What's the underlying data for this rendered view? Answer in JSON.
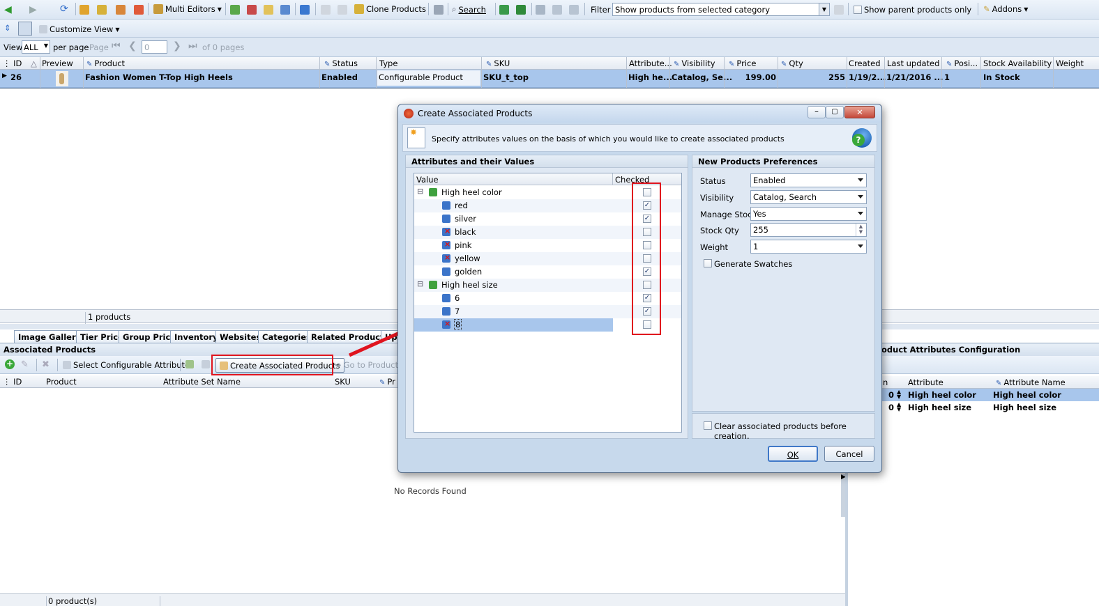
{
  "toolbar": {
    "multi_editors": "Multi Editors",
    "clone": "Clone Products",
    "search": "Search",
    "filter_label": "Filter",
    "filter_value": "Show products from selected category",
    "show_parent": "Show parent products only",
    "addons": "Addons"
  },
  "toolbar2": {
    "customize": "Customize View"
  },
  "pager": {
    "view": "View",
    "per_page_value": "ALL",
    "per_page": "per page",
    "page": "Page",
    "page_input": "0",
    "of_pages": "of 0 pages"
  },
  "grid": {
    "headers": [
      "ID",
      "Preview",
      "Product",
      "Status",
      "Type",
      "SKU",
      "Attribute...",
      "Visibility",
      "Price",
      "Qty",
      "Created",
      "Last updated",
      "Posi...",
      "Stock Availability",
      "Weight"
    ],
    "row": {
      "id": "26",
      "product": "Fashion Women T-Top High Heels",
      "status": "Enabled",
      "type": "Configurable Product",
      "sku": "SKU_t_top",
      "attribute": "High he...",
      "visibility": "Catalog, Se...",
      "price": "199.00",
      "qty": "255",
      "created": "1/19/2...",
      "updated": "1/21/2016 ...",
      "position": "1",
      "stock": "In Stock"
    },
    "count": "1 products"
  },
  "tabs": [
    "Image Gallery",
    "Tier Price",
    "Group Price",
    "Inventory",
    "Websites",
    "Categories",
    "Related Products",
    "Up"
  ],
  "assoc": {
    "title": "Associated Products",
    "select_btn": "Select Configurable Attributes",
    "create_btn": "Create Associated Products",
    "goto_btn": "Go to Product",
    "headers": [
      "ID",
      "Product",
      "Attribute Set Name",
      "SKU",
      "Pr"
    ],
    "empty": "No Records Found",
    "count": "0 product(s)"
  },
  "config": {
    "title": "oduct Attributes Configuration",
    "headers": [
      "n",
      "Attribute",
      "Attribute Name"
    ],
    "rows": [
      {
        "pos": "0",
        "attr": "High heel color",
        "name": "High heel color"
      },
      {
        "pos": "0",
        "attr": "High heel size",
        "name": "High heel size"
      }
    ]
  },
  "dialog": {
    "title": "Create Associated Products",
    "desc": "Specify attributes values on the basis of which you would like to create associated products",
    "left_title": "Attributes and their Values",
    "col_value": "Value",
    "col_checked": "Checked",
    "tree": [
      {
        "label": "High heel color",
        "group": true,
        "checked": false
      },
      {
        "label": "red",
        "group": false,
        "checked": true,
        "used": false
      },
      {
        "label": "silver",
        "group": false,
        "checked": true,
        "used": false
      },
      {
        "label": "black",
        "group": false,
        "checked": false,
        "used": true
      },
      {
        "label": "pink",
        "group": false,
        "checked": false,
        "used": true
      },
      {
        "label": "yellow",
        "group": false,
        "checked": false,
        "used": true
      },
      {
        "label": "golden",
        "group": false,
        "checked": true,
        "used": false
      },
      {
        "label": "High heel size",
        "group": true,
        "checked": false
      },
      {
        "label": "6",
        "group": false,
        "checked": true,
        "used": false
      },
      {
        "label": "7",
        "group": false,
        "checked": true,
        "used": false
      },
      {
        "label": "8",
        "group": false,
        "checked": false,
        "used": true
      }
    ],
    "right_title": "New Products Preferences",
    "prefs": {
      "status_label": "Status",
      "status": "Enabled",
      "visibility_label": "Visibility",
      "visibility": "Catalog, Search",
      "stock_label": "Manage Stock",
      "stock": "Yes",
      "qty_label": "Stock Qty",
      "qty": "255",
      "weight_label": "Weight",
      "weight": "1",
      "swatches": "Generate Swatches",
      "clear": "Clear associated products before creation."
    },
    "ok": "OK",
    "cancel": "Cancel"
  },
  "colors": {
    "accent": "#e0141e",
    "selection": "#a8c6ec"
  }
}
